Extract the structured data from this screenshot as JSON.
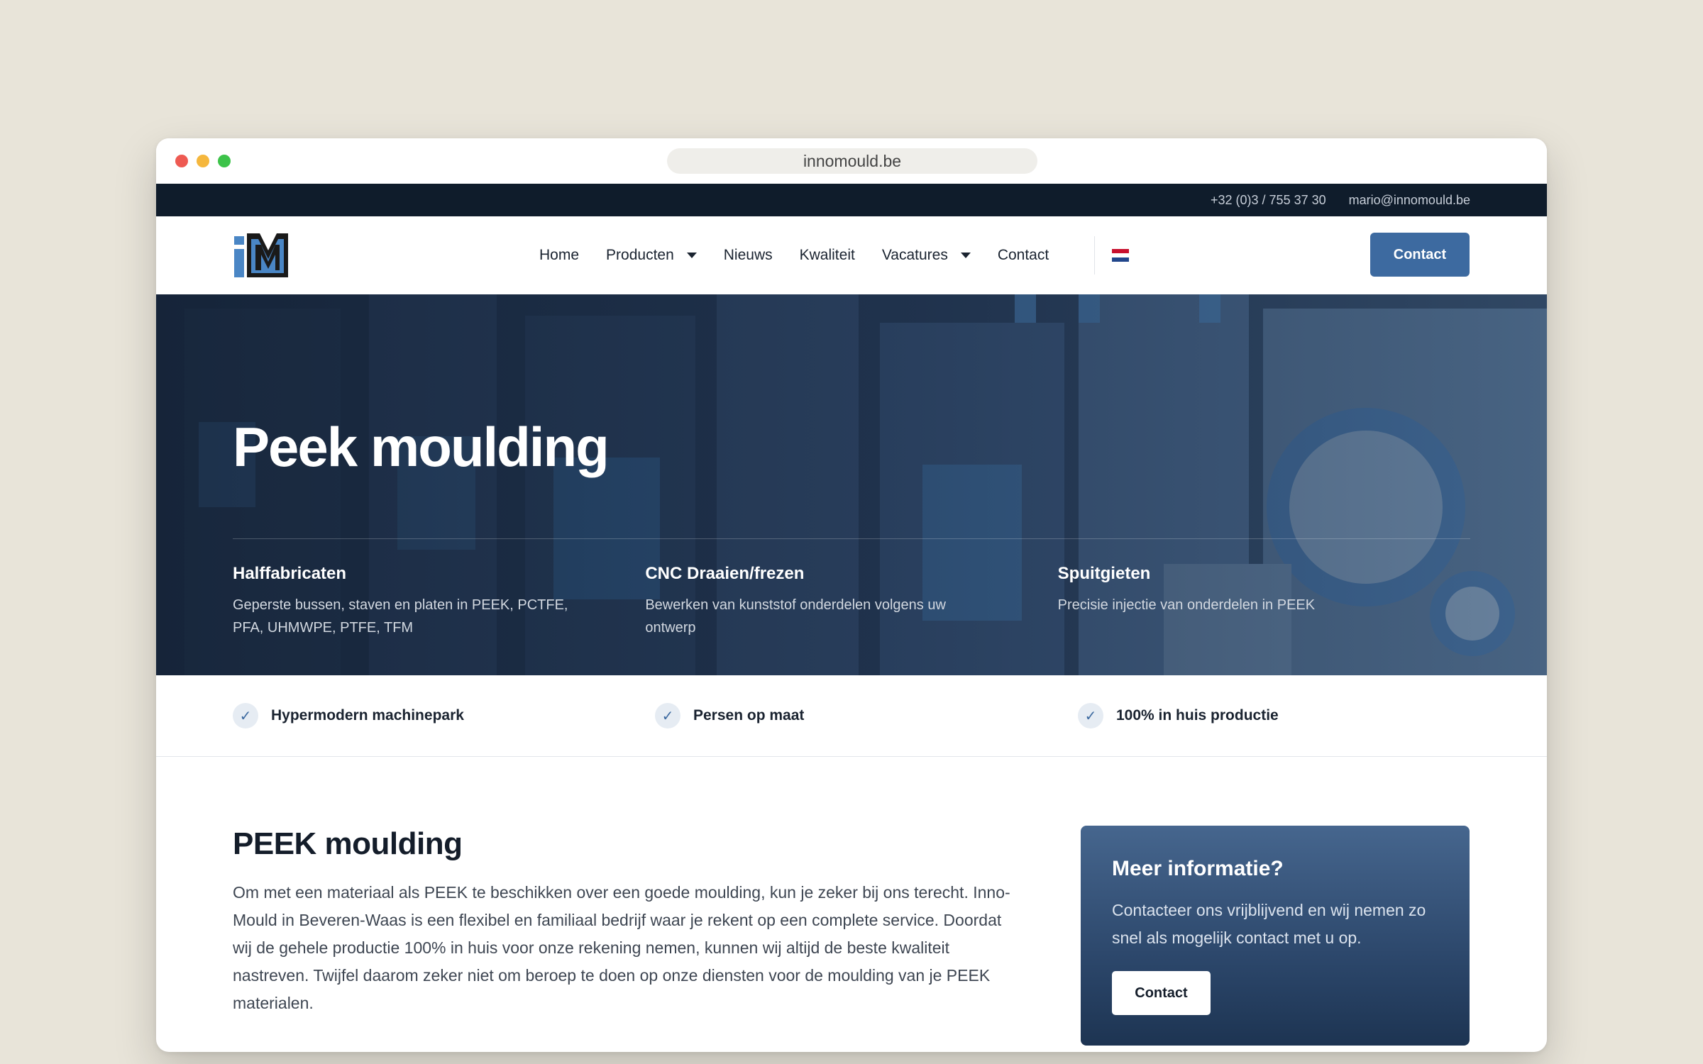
{
  "browser": {
    "url": "innomould.be"
  },
  "topbar": {
    "phone": "+32 (0)3 / 755 37 30",
    "email": "mario@innomould.be"
  },
  "nav": {
    "items": [
      {
        "label": "Home",
        "has_dropdown": false
      },
      {
        "label": "Producten",
        "has_dropdown": true
      },
      {
        "label": "Nieuws",
        "has_dropdown": false
      },
      {
        "label": "Kwaliteit",
        "has_dropdown": false
      },
      {
        "label": "Vacatures",
        "has_dropdown": true
      },
      {
        "label": "Contact",
        "has_dropdown": false
      }
    ],
    "language_icon": "netherlands-flag-icon",
    "contact_button": "Contact"
  },
  "hero": {
    "title": "Peek moulding",
    "columns": [
      {
        "title": "Halffabricaten",
        "text": "Geperste bussen, staven en platen in PEEK, PCTFE, PFA, UHMWPE, PTFE, TFM"
      },
      {
        "title": "CNC Draaien/frezen",
        "text": "Bewerken van kunststof onderdelen volgens uw ontwerp"
      },
      {
        "title": "Spuitgieten",
        "text": "Precisie injectie van onderdelen in PEEK"
      }
    ]
  },
  "features": [
    {
      "icon": "check-icon",
      "label": "Hypermodern machinepark"
    },
    {
      "icon": "check-icon",
      "label": "Persen op maat"
    },
    {
      "icon": "check-icon",
      "label": "100% in huis productie"
    }
  ],
  "content": {
    "title": "PEEK moulding",
    "body": "Om met een materiaal als PEEK te beschikken over een goede moulding, kun je zeker bij ons terecht. Inno-Mould in Beveren-Waas is een flexibel en familiaal bedrijf waar je rekent op een complete service. Doordat wij de gehele productie 100% in huis voor onze rekening nemen, kunnen wij altijd de beste kwaliteit nastreven. Twijfel daarom zeker niet om beroep te doen op onze diensten voor de moulding van je PEEK materialen."
  },
  "infocard": {
    "title": "Meer informatie?",
    "text": "Contacteer ons vrijblijvend en wij nemen zo snel als mogelijk contact met u op.",
    "button": "Contact"
  },
  "colors": {
    "accent": "#3d6aa0",
    "topbar": "#0f1c2b",
    "background": "#e8e4d9"
  }
}
